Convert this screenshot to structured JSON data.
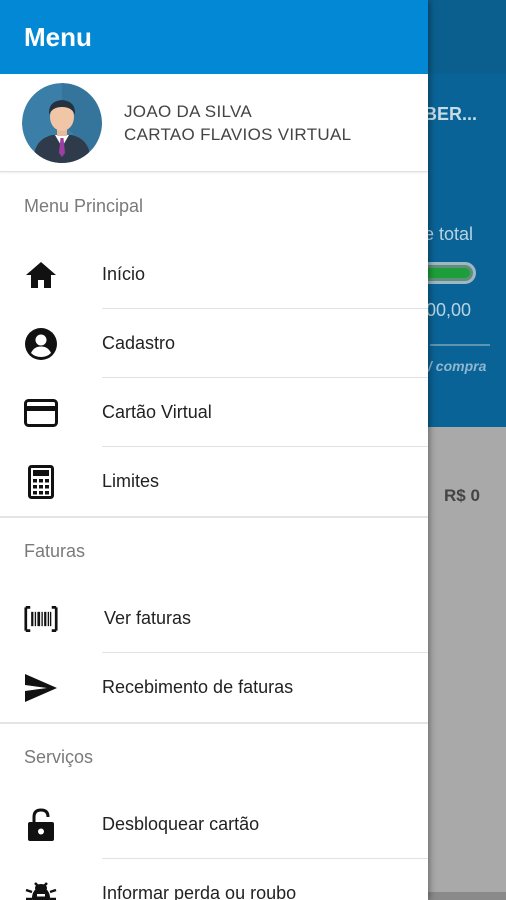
{
  "background": {
    "card_name": "BER...",
    "limit_total": "e total",
    "amount": "00,00",
    "compra": "/ compra",
    "balance": "R$ 0"
  },
  "drawer": {
    "title": "Menu",
    "profile": {
      "name": "JOAO DA SILVA",
      "card": "CARTAO FLAVIOS VIRTUAL"
    },
    "sections": {
      "principal": {
        "title": "Menu Principal",
        "items": [
          {
            "label": "Início",
            "icon": "home-icon"
          },
          {
            "label": "Cadastro",
            "icon": "account-circle-icon"
          },
          {
            "label": "Cartão Virtual",
            "icon": "credit-card-icon"
          },
          {
            "label": "Limites",
            "icon": "calculator-icon"
          }
        ]
      },
      "faturas": {
        "title": "Faturas",
        "items": [
          {
            "label": "Ver faturas",
            "icon": "barcode-icon"
          },
          {
            "label": "Recebimento de faturas",
            "icon": "send-icon"
          }
        ]
      },
      "servicos": {
        "title": "Serviços",
        "items": [
          {
            "label": "Desbloquear cartão",
            "icon": "lock-open-icon"
          },
          {
            "label": "Informar perda ou roubo",
            "icon": "bug-icon"
          }
        ]
      }
    }
  },
  "colors": {
    "drawer_header": "#0388d5",
    "app_header": "#0b5f8f",
    "progress_fill": "#1e9e3a"
  }
}
